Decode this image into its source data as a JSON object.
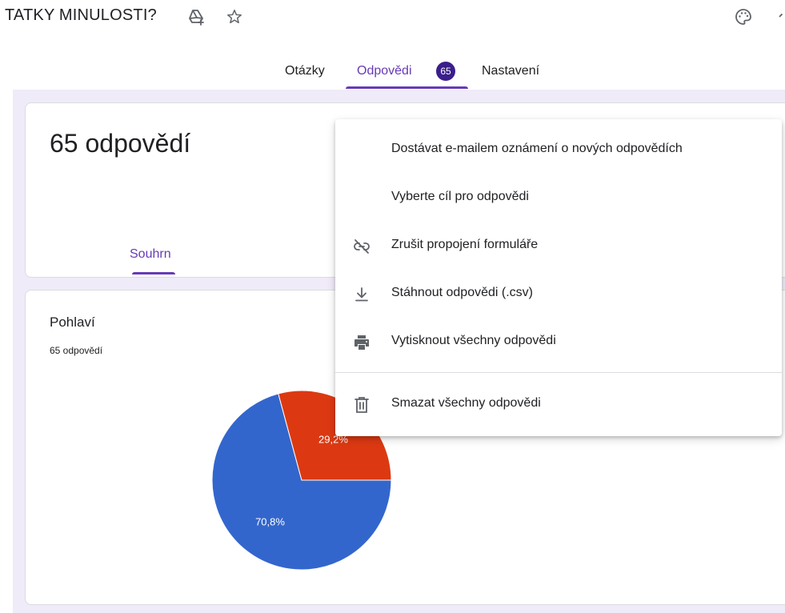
{
  "header": {
    "title": "TATKY MINULOSTI?",
    "icons": [
      "add-to-drive-icon",
      "star-icon",
      "palette-icon"
    ]
  },
  "tabs": {
    "questions": "Otázky",
    "responses": "Odpovědi",
    "responses_badge": "65",
    "settings": "Nastavení"
  },
  "summary_card": {
    "count": "65 odpovědí",
    "summary_tab": "Souhrn"
  },
  "question": {
    "title": "Pohlaví",
    "subtitle": "65 odpovědí"
  },
  "chart_data": {
    "type": "pie",
    "values": [
      70.8,
      29.2
    ],
    "labels": [
      "70,8%",
      "29,2%"
    ],
    "colors": [
      "#3366cc",
      "#dc3912"
    ]
  },
  "menu": {
    "items": [
      {
        "label": "Dostávat e-mailem oznámení o nových odpovědích",
        "icon": ""
      },
      {
        "label": "Vyberte cíl pro odpovědi",
        "icon": ""
      },
      {
        "label": "Zrušit propojení formuláře",
        "icon": "unlink-icon"
      },
      {
        "label": "Stáhnout odpovědi (.csv)",
        "icon": "download-icon"
      },
      {
        "label": "Vytisknout všechny odpovědi",
        "icon": "print-icon"
      },
      {
        "label": "Smazat všechny odpovědi",
        "icon": "trash-icon"
      }
    ]
  }
}
